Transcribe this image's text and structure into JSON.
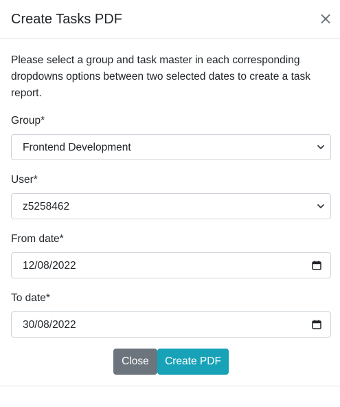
{
  "modal": {
    "title": "Create Tasks PDF",
    "close_symbol": "×",
    "intro": "Please select a group and task master in each corresponding dropdowns options between two selected dates to create a task report."
  },
  "form": {
    "group": {
      "label": "Group*",
      "value": "Frontend Development",
      "icon": "chevron-down-icon"
    },
    "user": {
      "label": "User*",
      "value": "z5258462",
      "icon": "chevron-down-icon"
    },
    "from_date": {
      "label": "From date*",
      "value": "12/08/2022",
      "icon": "calendar-icon"
    },
    "to_date": {
      "label": "To date*",
      "value": "30/08/2022",
      "icon": "calendar-icon"
    }
  },
  "footer": {
    "close_label": "Close",
    "create_label": "Create PDF"
  },
  "colors": {
    "close_button": "#6c757d",
    "create_button": "#17a2b8",
    "border": "#ced4da",
    "divider": "#dee2e6"
  }
}
